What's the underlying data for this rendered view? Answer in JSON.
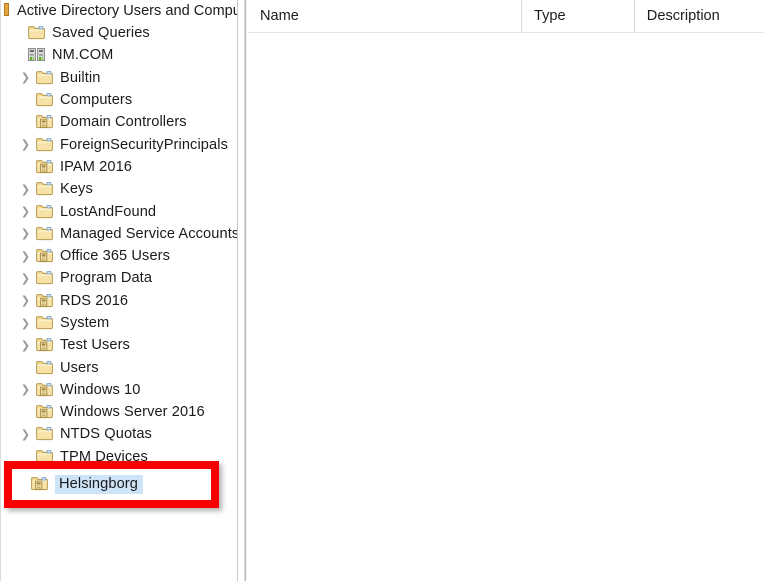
{
  "window": {
    "title": "Active Directory Users and Computers",
    "root_icon": "console-root-icon"
  },
  "colors": {
    "annotation_red": "#f80000",
    "selection_blue": "#cde3f7",
    "folder_yellow": "#f5dfa0",
    "chevron_gray": "#9a9a9a"
  },
  "tree": {
    "name": "Active Directory Users and Computers tree",
    "items": [
      {
        "label": "Saved Queries",
        "icon": "folder-icon",
        "level": 1,
        "expandable": false,
        "selected": false
      },
      {
        "label": "NM.COM",
        "icon": "domain-icon",
        "level": 1,
        "expandable": false,
        "selected": false
      },
      {
        "label": "Builtin",
        "icon": "folder-icon",
        "level": 2,
        "expandable": true,
        "selected": false
      },
      {
        "label": "Computers",
        "icon": "folder-icon",
        "level": 2,
        "expandable": false,
        "selected": false
      },
      {
        "label": "Domain Controllers",
        "icon": "ou-folder-icon",
        "level": 2,
        "expandable": false,
        "selected": false
      },
      {
        "label": "ForeignSecurityPrincipals",
        "icon": "folder-icon",
        "level": 2,
        "expandable": true,
        "selected": false
      },
      {
        "label": "IPAM 2016",
        "icon": "ou-folder-icon",
        "level": 2,
        "expandable": false,
        "selected": false
      },
      {
        "label": "Keys",
        "icon": "folder-icon",
        "level": 2,
        "expandable": true,
        "selected": false
      },
      {
        "label": "LostAndFound",
        "icon": "folder-icon",
        "level": 2,
        "expandable": true,
        "selected": false
      },
      {
        "label": "Managed Service Accounts",
        "icon": "folder-icon",
        "level": 2,
        "expandable": true,
        "selected": false
      },
      {
        "label": "Office 365 Users",
        "icon": "ou-folder-icon",
        "level": 2,
        "expandable": true,
        "selected": false
      },
      {
        "label": "Program Data",
        "icon": "folder-icon",
        "level": 2,
        "expandable": true,
        "selected": false
      },
      {
        "label": "RDS 2016",
        "icon": "ou-folder-icon",
        "level": 2,
        "expandable": true,
        "selected": false
      },
      {
        "label": "System",
        "icon": "folder-icon",
        "level": 2,
        "expandable": true,
        "selected": false
      },
      {
        "label": "Test Users",
        "icon": "ou-folder-icon",
        "level": 2,
        "expandable": true,
        "selected": false
      },
      {
        "label": "Users",
        "icon": "folder-icon",
        "level": 2,
        "expandable": false,
        "selected": false
      },
      {
        "label": "Windows 10",
        "icon": "ou-folder-icon",
        "level": 2,
        "expandable": true,
        "selected": false
      },
      {
        "label": "Windows Server 2016",
        "icon": "ou-folder-icon",
        "level": 2,
        "expandable": false,
        "selected": false
      },
      {
        "label": "NTDS Quotas",
        "icon": "folder-icon",
        "level": 2,
        "expandable": true,
        "selected": false
      },
      {
        "label": "TPM Devices",
        "icon": "folder-icon",
        "level": 2,
        "expandable": false,
        "selected": false
      }
    ],
    "highlighted_item": {
      "label": "Helsingborg",
      "icon": "ou-folder-icon",
      "level": 2,
      "expandable": false,
      "selected": true
    }
  },
  "list_pane": {
    "columns": [
      {
        "label": "Name"
      },
      {
        "label": "Type"
      },
      {
        "label": "Description"
      }
    ],
    "rows": []
  }
}
